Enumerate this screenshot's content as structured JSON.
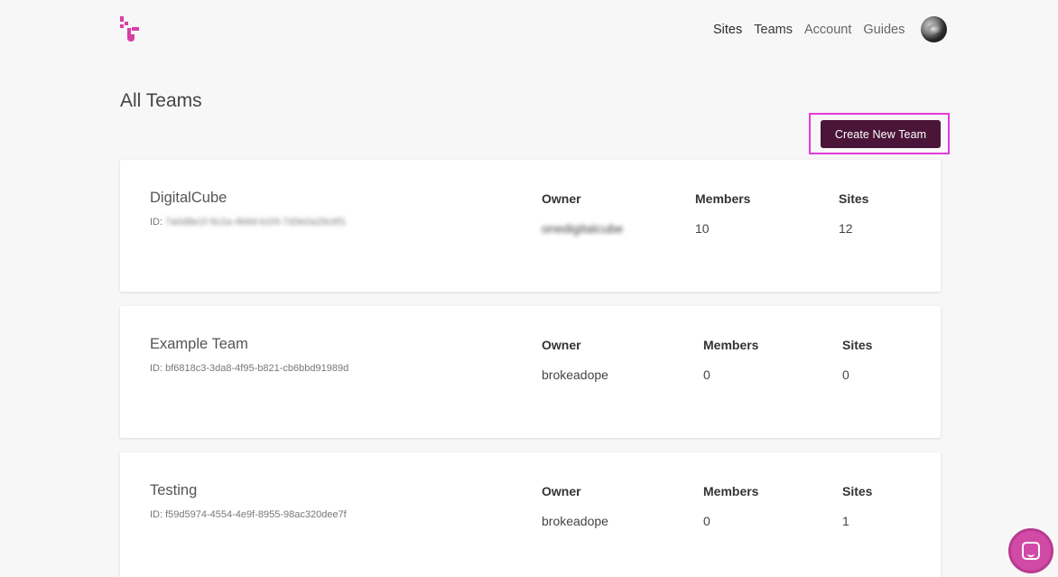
{
  "header": {
    "nav": [
      "Sites",
      "Teams",
      "Account",
      "Guides"
    ]
  },
  "page": {
    "title": "All Teams",
    "create_button": "Create New Team"
  },
  "columns": {
    "owner": "Owner",
    "members": "Members",
    "sites": "Sites"
  },
  "teams": [
    {
      "name": "DigitalCube",
      "id_label": "ID:",
      "id_value": "7a0d8e1f-9c2a-4b6d-b1f4-7d3e0a29c6f1",
      "owner": "onedigitalcube",
      "members": "10",
      "sites": "12"
    },
    {
      "name": "Example Team",
      "id_label": "ID:",
      "id_value": "bf6818c3-3da8-4f95-b821-cb6bbd91989d",
      "owner": "brokeadope",
      "members": "0",
      "sites": "0"
    },
    {
      "name": "Testing",
      "id_label": "ID:",
      "id_value": "f59d5974-4554-4e9f-8955-98ac320dee7f",
      "owner": "brokeadope",
      "members": "0",
      "sites": "1"
    }
  ],
  "colors": {
    "accent": "#4a1539",
    "highlight": "#e53ad9",
    "brand": "#d83fa5"
  }
}
